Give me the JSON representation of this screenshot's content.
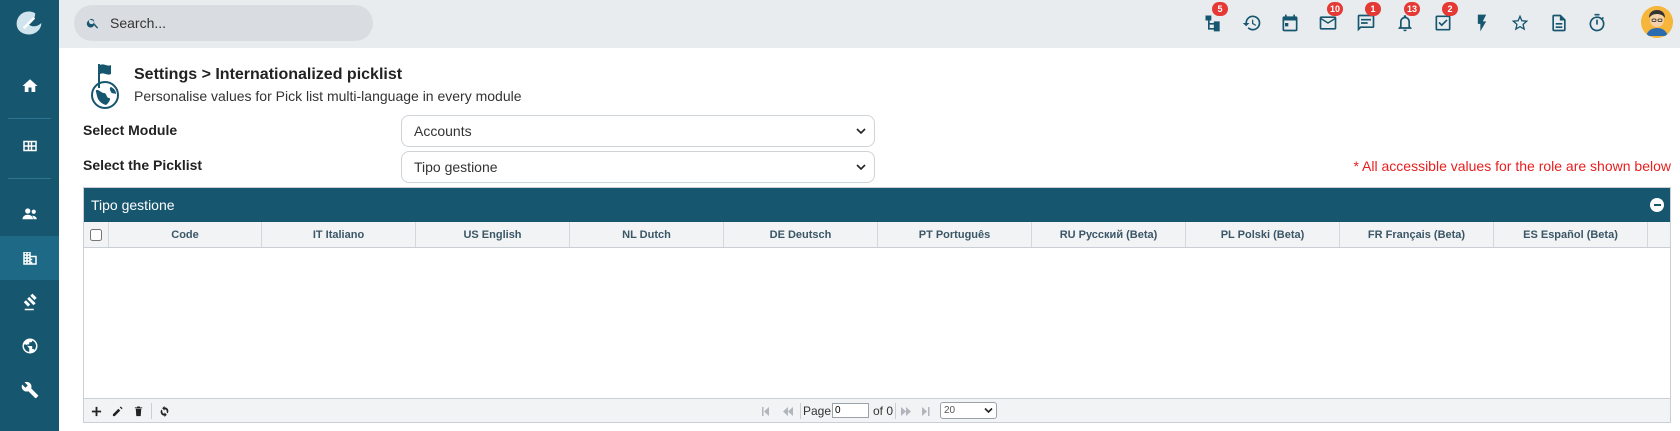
{
  "search": {
    "placeholder": "Search..."
  },
  "sidebar": {
    "items": [
      {
        "icon": "home-icon"
      },
      {
        "icon": "grid-icon"
      },
      {
        "icon": "users-icon"
      },
      {
        "icon": "building-icon"
      },
      {
        "icon": "gavel-icon"
      },
      {
        "icon": "globe-icon"
      },
      {
        "icon": "wrench-icon"
      }
    ]
  },
  "topbar": {
    "icons": [
      {
        "icon": "hierarchy-icon",
        "badge": "5"
      },
      {
        "icon": "history-icon",
        "badge": ""
      },
      {
        "icon": "calendar-icon",
        "badge": ""
      },
      {
        "icon": "mail-icon",
        "badge": "10"
      },
      {
        "icon": "chat-icon",
        "badge": "1"
      },
      {
        "icon": "bell-icon",
        "badge": "13"
      },
      {
        "icon": "checklist-icon",
        "badge": "2"
      },
      {
        "icon": "lightning-icon",
        "badge": ""
      },
      {
        "icon": "star-icon",
        "badge": ""
      },
      {
        "icon": "document-icon",
        "badge": ""
      },
      {
        "icon": "stopwatch-icon",
        "badge": ""
      }
    ]
  },
  "header": {
    "title": "Settings > Internationalized picklist",
    "subtitle": "Personalise values for Pick list multi-language in every module"
  },
  "form": {
    "module_label": "Select Module",
    "module_value": "Accounts",
    "picklist_label": "Select the Picklist",
    "picklist_value": "Tipo gestione",
    "notice": "* All accessible values for the role are shown below"
  },
  "grid": {
    "caption": "Tipo gestione",
    "columns": [
      "Code",
      "IT Italiano",
      "US English",
      "NL Dutch",
      "DE Deutsch",
      "PT Português",
      "RU Русский (Beta)",
      "PL Polski (Beta)",
      "FR Français (Beta)",
      "ES Español (Beta)"
    ],
    "rows": []
  },
  "pager": {
    "page_label": "Page",
    "page_value": "0",
    "of_label": "of 0",
    "page_size": "20"
  },
  "colors": {
    "primary": "#17566f",
    "badge": "#e53935",
    "notice": "#e91e1e"
  }
}
